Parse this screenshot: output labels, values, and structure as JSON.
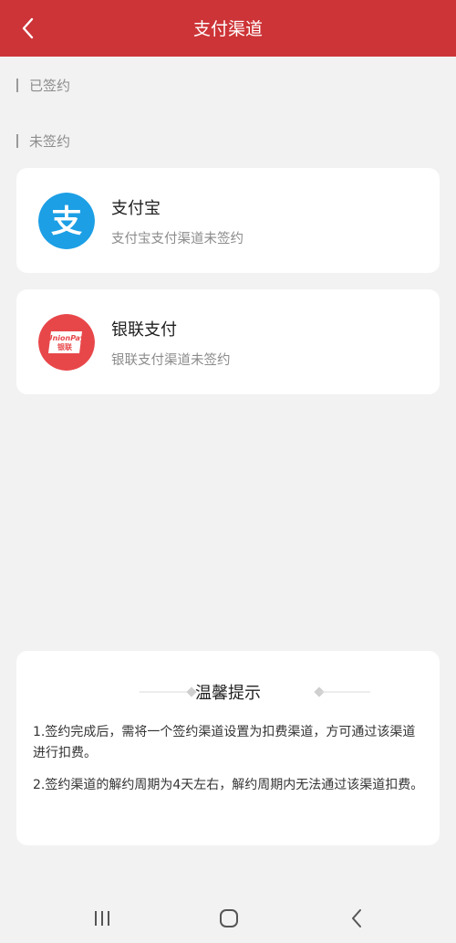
{
  "header": {
    "title": "支付渠道"
  },
  "sections": {
    "signed": "已签约",
    "unsigned": "未签约"
  },
  "channels": [
    {
      "name": "支付宝",
      "status": "支付宝支付渠道未签约",
      "logo_glyph": "支",
      "icon": "alipay-logo-icon",
      "color": "#1c9fe5"
    },
    {
      "name": "银联支付",
      "status": "银联支付渠道未签约",
      "logo_text": "UnionPay",
      "logo_subtext": "银联",
      "icon": "unionpay-logo-icon",
      "color": "#e8474a"
    }
  ],
  "tips": {
    "title": "温馨提示",
    "items": [
      "1.签约完成后，需将一个签约渠道设置为扣费渠道，方可通过该渠道进行扣费。",
      "2.签约渠道的解约周期为4天左右，解约周期内无法通过该渠道扣费。"
    ]
  },
  "navbar": {
    "icons": [
      "recent-apps-icon",
      "home-icon",
      "back-icon"
    ]
  },
  "colors": {
    "header_bg": "#cd3437",
    "page_bg": "#f2f2f2"
  }
}
